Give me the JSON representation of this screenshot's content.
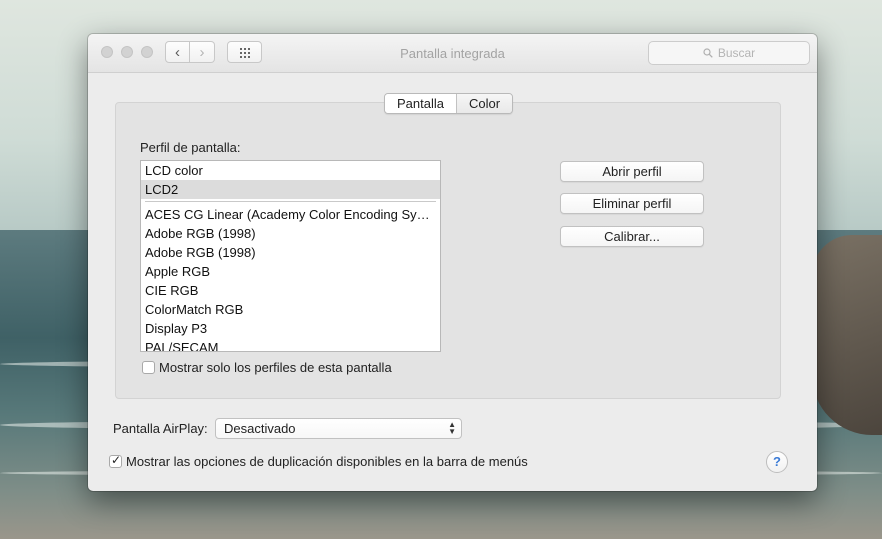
{
  "window": {
    "title": "Pantalla integrada",
    "search_placeholder": "Buscar"
  },
  "tabs": [
    {
      "label": "Pantalla",
      "active": true
    },
    {
      "label": "Color",
      "active": false
    }
  ],
  "color_tab": {
    "profile_label": "Perfil de pantalla:",
    "top_profiles": [
      "LCD color",
      "LCD2"
    ],
    "selected_profile": "LCD2",
    "profiles": [
      "ACES CG Linear (Academy Color Encoding Sy…",
      "Adobe RGB (1998)",
      "Adobe RGB (1998)",
      "Apple RGB",
      "CIE RGB",
      "ColorMatch RGB",
      "Display P3",
      "PAL/SECAM"
    ],
    "buttons": {
      "open": "Abrir perfil",
      "delete": "Eliminar perfil",
      "calibrate": "Calibrar..."
    },
    "only_this_display_label": "Mostrar solo los perfiles de esta pantalla",
    "only_this_display_checked": false
  },
  "airplay": {
    "label": "Pantalla AirPlay:",
    "value": "Desactivado"
  },
  "mirroring": {
    "label": "Mostrar las opciones de duplicación disponibles en la barra de menús",
    "checked": true
  },
  "help_label": "?"
}
